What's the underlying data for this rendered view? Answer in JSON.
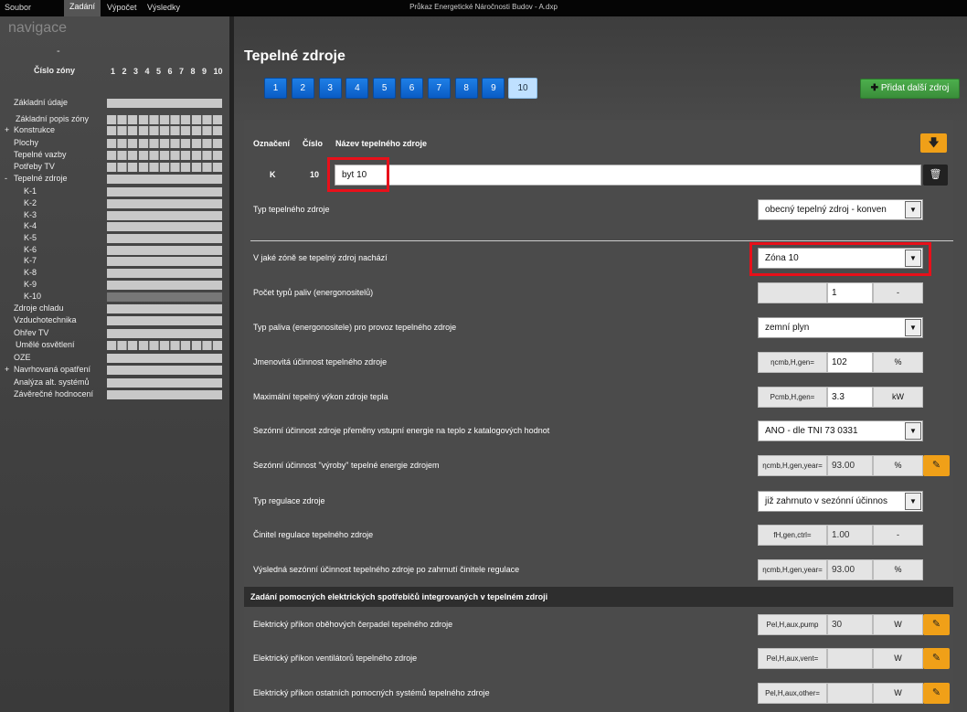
{
  "menubar": {
    "file": "Soubor",
    "input": "Zadání",
    "calc": "Výpočet",
    "results": "Výsledky"
  },
  "window_title": "Průkaz Energetické Náročnosti Budov - A.dxp",
  "sidebar": {
    "title": "navigace",
    "dash": "-",
    "zone_header": "Číslo zóny",
    "zone_numbers": [
      "1",
      "2",
      "3",
      "4",
      "5",
      "6",
      "7",
      "8",
      "9",
      "10"
    ],
    "items": [
      {
        "label": "Základní údaje",
        "plus": ""
      },
      {
        "label": "Základní popis zóny",
        "plus": ""
      },
      {
        "label": "Konstrukce",
        "plus": "+"
      },
      {
        "label": "Plochy",
        "plus": ""
      },
      {
        "label": "Tepelné vazby",
        "plus": ""
      },
      {
        "label": "Potřeby TV",
        "plus": ""
      },
      {
        "label": "Tepelné zdroje",
        "plus": "-"
      },
      {
        "label": "K-1",
        "plus": ""
      },
      {
        "label": "K-2",
        "plus": ""
      },
      {
        "label": "K-3",
        "plus": ""
      },
      {
        "label": "K-4",
        "plus": ""
      },
      {
        "label": "K-5",
        "plus": ""
      },
      {
        "label": "K-6",
        "plus": ""
      },
      {
        "label": "K-7",
        "plus": ""
      },
      {
        "label": "K-8",
        "plus": ""
      },
      {
        "label": "K-9",
        "plus": ""
      },
      {
        "label": "K-10",
        "plus": ""
      },
      {
        "label": "Zdroje chladu",
        "plus": ""
      },
      {
        "label": "Vzduchotechnika",
        "plus": ""
      },
      {
        "label": "Ohřev TV",
        "plus": ""
      },
      {
        "label": "Umělé osvětlení",
        "plus": ""
      },
      {
        "label": "OZE",
        "plus": ""
      },
      {
        "label": "Navrhovaná opatření",
        "plus": "+"
      },
      {
        "label": "Analýza alt. systémů",
        "plus": ""
      },
      {
        "label": "Závěrečné hodnocení",
        "plus": ""
      }
    ]
  },
  "page": {
    "title": "Tepelné zdroje",
    "tabs": [
      "1",
      "2",
      "3",
      "4",
      "5",
      "6",
      "7",
      "8",
      "9",
      "10"
    ],
    "active_tab": "10",
    "add_button": "Přidat další zdroj"
  },
  "form": {
    "col_mark": "Označení",
    "col_number": "Číslo",
    "col_name": "Název tepelného zdroje",
    "mark": "K",
    "number": "10",
    "name_value": "byt 10",
    "type_label": "Typ tepelného zdroje",
    "type_value": "obecný tepelný zdroj - konven",
    "zone_label": "V jaké zóně se tepelný zdroj nachází",
    "zone_value": "Zóna 10",
    "fuel_count_label": "Počet typů paliv (energonositelů)",
    "fuel_count_value": "1",
    "fuel_count_unit": "-",
    "fuel_type_label": "Typ paliva (energonositele) pro provoz tepelného zdroje",
    "fuel_type_value": "zemní plyn",
    "eff_label": "Jmenovitá účinnost tepelného zdroje",
    "eff_symbol": "ηcmb,H,gen=",
    "eff_value": "102",
    "eff_unit": "%",
    "power_label": "Maximální tepelný výkon zdroje tepla",
    "power_symbol": "Pcmb,H,gen=",
    "power_value": "3.3",
    "power_unit": "kW",
    "seasonal_src_label": "Sezónní účinnost zdroje přeměny vstupní energie na teplo z katalogových hodnot",
    "seasonal_src_value": "ANO - dle TNI 73 0331",
    "seasonal_label": "Sezónní účinnost \"výroby\" tepelné energie zdrojem",
    "seasonal_symbol": "ηcmb,H,gen,year=",
    "seasonal_value": "93.00",
    "seasonal_unit": "%",
    "reg_type_label": "Typ regulace zdroje",
    "reg_type_value": "již zahrnuto v sezónní účinnos",
    "reg_factor_label": "Činitel regulace tepelného zdroje",
    "reg_factor_symbol": "fH,gen,ctrl=",
    "reg_factor_value": "1.00",
    "reg_factor_unit": "-",
    "result_label": "Výsledná sezónní účinnost tepelného zdroje po zahrnutí činitele regulace",
    "result_symbol": "ηcmb,H,gen,year=",
    "result_value": "93.00",
    "result_unit": "%",
    "aux_header": "Zadání pomocných elektrických spotřebičů integrovaných v tepelném zdroji",
    "pump_label": "Elektrický příkon oběhových čerpadel tepelného zdroje",
    "pump_symbol": "Pel,H,aux,pump",
    "pump_value": "30",
    "pump_unit": "W",
    "vent_label": "Elektrický příkon ventilátorů tepelného zdroje",
    "vent_symbol": "Pel,H,aux,vent=",
    "vent_value": "",
    "vent_unit": "W",
    "other_label": "Elektrický příkon ostatních pomocných systémů tepelného zdroje",
    "other_symbol": "Pel,H,aux,other=",
    "other_value": "",
    "other_unit": "W"
  },
  "colors": {
    "accent_orange": "#f0a018",
    "tab_blue": "#1e7fe6",
    "add_green": "#4cae4c",
    "highlight_red": "#e8101a"
  }
}
